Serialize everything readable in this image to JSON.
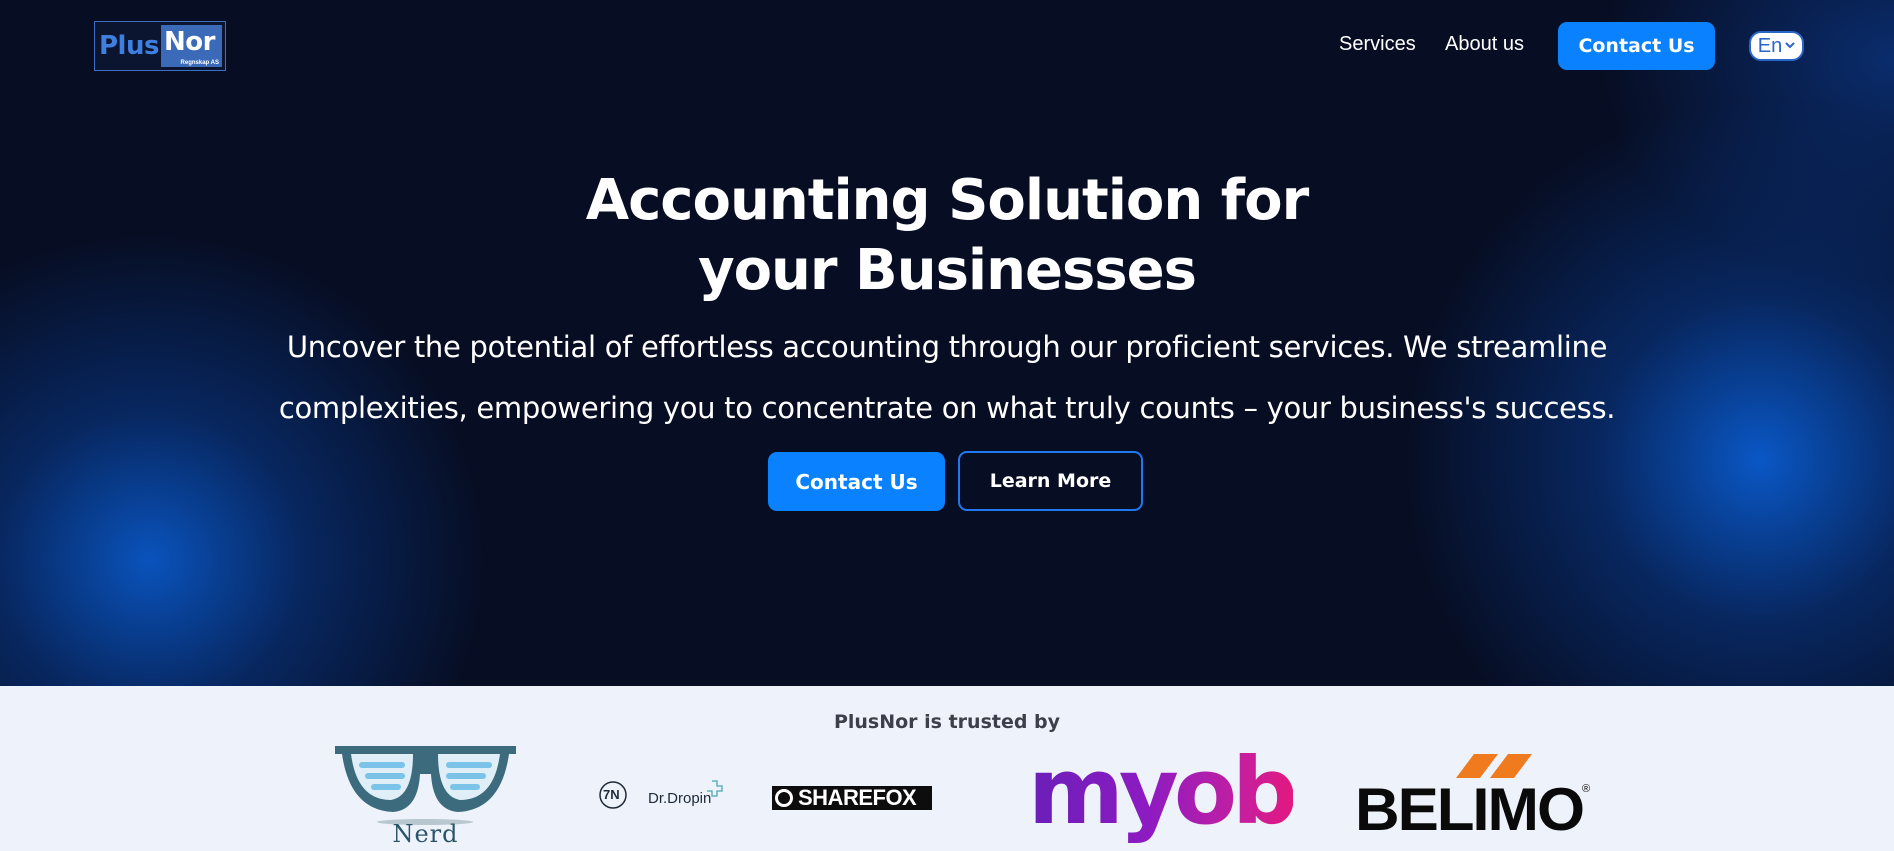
{
  "header": {
    "logo_plus": "Plus",
    "logo_nor": "Nor",
    "logo_sub": "Regnskap AS",
    "nav": [
      {
        "label": "Services"
      },
      {
        "label": "About us"
      }
    ],
    "contact_label": "Contact Us",
    "language": "En",
    "language_icon": "chevron-down-icon"
  },
  "hero": {
    "title_line1": "Accounting Solution for",
    "title_line2": "your Businesses",
    "subtitle": "Uncover the potential of effortless accounting through our proficient services. We streamline complexities, empowering you to concentrate on what truly counts – your business's success.",
    "primary_button": "Contact Us",
    "secondary_button": "Learn More"
  },
  "trusted": {
    "title": "PlusNor is trusted by",
    "brands": [
      {
        "name": "Nerd",
        "word": "Nerd"
      },
      {
        "name": "7N Dr.Dropin",
        "mark": "7N",
        "word": "Dr.Dropin"
      },
      {
        "name": "Sharefox",
        "word": "SHAREFOX"
      },
      {
        "name": "myob",
        "word": "myob"
      },
      {
        "name": "Belimo",
        "word": "BELIMO",
        "reg": "®"
      }
    ]
  },
  "colors": {
    "accent": "#0a82ff",
    "hero_bg": "#070d22",
    "band_bg": "#eef2fb"
  }
}
